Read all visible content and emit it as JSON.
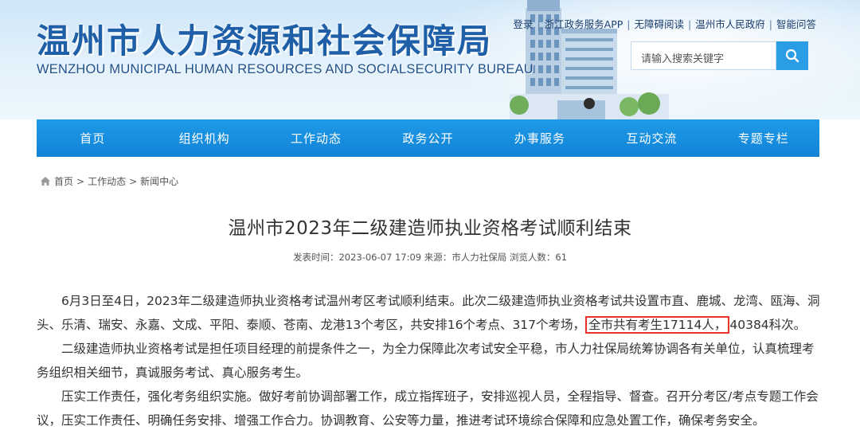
{
  "header": {
    "title": "温州市人力资源和社会保障局",
    "subtitle": "WENZHOU MUNICIPAL HUMAN RESOURCES AND SOCIALSECURITY BUREAU",
    "top_links": [
      "登录",
      "浙江政务服务APP",
      "无障碍阅读",
      "温州市人民政府",
      "智能问答"
    ],
    "search_placeholder": "请输入搜索关键字"
  },
  "nav": {
    "items": [
      "首页",
      "组织机构",
      "工作动态",
      "政务公开",
      "办事服务",
      "互动交流",
      "专题专栏"
    ]
  },
  "breadcrumb": {
    "items": [
      "首页",
      "工作动态",
      "新闻中心"
    ],
    "separator": ">"
  },
  "article": {
    "title": "温州市2023年二级建造师执业资格考试顺利结束",
    "meta": "发表时间：2023-06-07 17:09  来源：市人力社保局  浏览人数：61",
    "p1_before": "6月3日至4日，2023年二级建造师执业资格考试温州考区考试顺利结束。此次二级建造师执业资格考试共设置市直、鹿城、龙湾、瓯海、洞头、乐清、瑞安、永嘉、文成、平阳、泰顺、苍南、龙港13个考区，共安排16个考点、317个考场，",
    "p1_highlight": "全市共有考生17114人，",
    "p1_after": "40384科次。",
    "p2": "二级建造师执业资格考试是担任项目经理的前提条件之一，为全力保障此次考试安全平稳，市人力社保局统筹协调各有关单位，认真梳理考务组织相关细节，真诚服务考试、真心服务考生。",
    "p3": "压实工作责任，强化考务组织实施。做好考前协调部署工作，成立指挥班子，安排巡视人员，全程指导、督查。召开分考区/考点专题工作会议，压实工作责任、明确任务安排、增强工作合力。协调教育、公安等力量，推进考试环境综合保障和应急处置工作，确保考务安全。"
  },
  "colors": {
    "nav_bg": "#1183d6",
    "title_blue": "#1f5fa8",
    "search_button": "#2b9ce6",
    "highlight_border": "#e8322b"
  },
  "icons": [
    "search-icon",
    "home-icon"
  ]
}
